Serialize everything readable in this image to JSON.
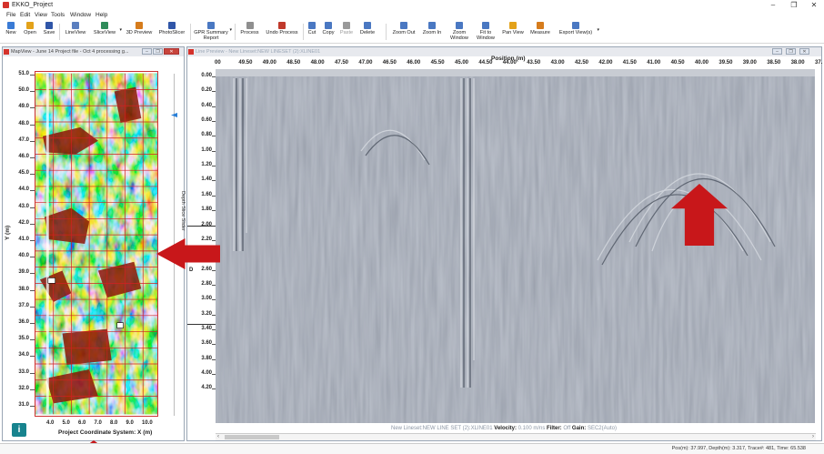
{
  "app": {
    "title": "EKKO_Project",
    "window_controls": [
      "–",
      "❐",
      "✕"
    ]
  },
  "menu": [
    "File",
    "Edit",
    "View",
    "Tools",
    "Window",
    "Help"
  ],
  "toolbar": [
    {
      "label": "New",
      "icon": "new-file-icon",
      "color": "#3a7bd5"
    },
    {
      "label": "Open",
      "icon": "open-folder-icon",
      "color": "#e3a21a"
    },
    {
      "label": "Save",
      "icon": "save-icon",
      "color": "#3056a8"
    },
    {
      "label": "LineView",
      "icon": "line-view-icon",
      "color": "#5b7fbf"
    },
    {
      "label": "SliceView",
      "icon": "slice-view-icon",
      "color": "#2f8c5a"
    },
    {
      "label": "3D Preview",
      "icon": "3d-preview-icon",
      "color": "#d67c1c"
    },
    {
      "label": "PhotoSlicer",
      "icon": "photoslicer-icon",
      "color": "#3056a8"
    },
    {
      "label": "GPR Summary Report",
      "icon": "gpr-report-icon",
      "color": "#4a78c2"
    },
    {
      "label": "Process",
      "icon": "process-icon",
      "color": "#8f8f8f"
    },
    {
      "label": "Undo Process",
      "icon": "undo-process-icon",
      "color": "#c0392b"
    },
    {
      "label": "Cut",
      "icon": "cut-icon",
      "color": "#4a78c2"
    },
    {
      "label": "Copy",
      "icon": "copy-icon",
      "color": "#4a78c2"
    },
    {
      "label": "Paste",
      "icon": "paste-icon",
      "color": "#9a9a9a"
    },
    {
      "label": "Delete",
      "icon": "delete-icon",
      "color": "#4a78c2"
    },
    {
      "label": "Zoom Out",
      "icon": "zoom-out-icon",
      "color": "#4a78c2"
    },
    {
      "label": "Zoom In",
      "icon": "zoom-in-icon",
      "color": "#4a78c2"
    },
    {
      "label": "Zoom Window",
      "icon": "zoom-window-icon",
      "color": "#4a78c2"
    },
    {
      "label": "Fit to Window",
      "icon": "fit-window-icon",
      "color": "#4a78c2"
    },
    {
      "label": "Pan View",
      "icon": "pan-hand-icon",
      "color": "#e3a21a"
    },
    {
      "label": "Measure",
      "icon": "measure-icon",
      "color": "#d67c1c"
    },
    {
      "label": "Export View(s)",
      "icon": "export-view-icon",
      "color": "#4a78c2"
    }
  ],
  "map_view": {
    "title": "MapView - June 14 Project file - Oct 4 processing g...",
    "y_ticks": [
      "51.0",
      "50.0",
      "49.0",
      "48.0",
      "47.0",
      "46.0",
      "45.0",
      "44.0",
      "43.0",
      "42.0",
      "41.0",
      "40.0",
      "39.0",
      "38.0",
      "37.0",
      "36.0",
      "35.0",
      "34.0",
      "33.0",
      "32.0",
      "31.0"
    ],
    "x_ticks": [
      "4.0",
      "5.0",
      "6.0",
      "7.0",
      "8.0",
      "9.0",
      "10.0"
    ],
    "y_label": "Y (m)",
    "x_label": "Project Coordinate System: X (m)",
    "depth_slider_label": "Depth Slice Slider",
    "icon_letter": "i"
  },
  "line_preview": {
    "title": "Line Preview - New Lineset:NEW LINESET (2):XLINE01",
    "position_label": "Position (m)",
    "position_ticks": [
      "00",
      "49.50",
      "49.00",
      "48.50",
      "48.00",
      "47.50",
      "47.00",
      "46.50",
      "46.00",
      "45.50",
      "45.00",
      "44.50",
      "44.00",
      "43.50",
      "43.00",
      "42.50",
      "42.00",
      "41.50",
      "41.00",
      "40.50",
      "40.00",
      "39.50",
      "39.00",
      "38.50",
      "38.00",
      "37."
    ],
    "depth_ticks": [
      "0.00",
      "0.20",
      "0.40",
      "0.60",
      "0.80",
      "1.00",
      "1.20",
      "1.40",
      "1.60",
      "1.80",
      "2.00",
      "2.20",
      "2.40",
      "2.60",
      "2.80",
      "3.00",
      "3.20",
      "3.40",
      "3.60",
      "3.80",
      "4.00",
      "4.20"
    ],
    "depth_axis_letter": "D",
    "status": {
      "line": "New Lineset:NEW LINE SET (2):XLINE01",
      "velocity_label": "Velocity:",
      "velocity_value": "0.100 m/ns",
      "filter_label": "Filter:",
      "filter_value": "Off",
      "gain_label": "Gain:",
      "gain_value": "SEC2(Auto)"
    }
  },
  "statusbar": {
    "text": "Pos(m): 37.997, Depth(m): 3.317, Trace#: 481, Time: 65.538"
  },
  "colors": {
    "accent_red": "#c8171a",
    "slider_blue": "#2a80d8",
    "radar_gray": "#8c95a2"
  }
}
